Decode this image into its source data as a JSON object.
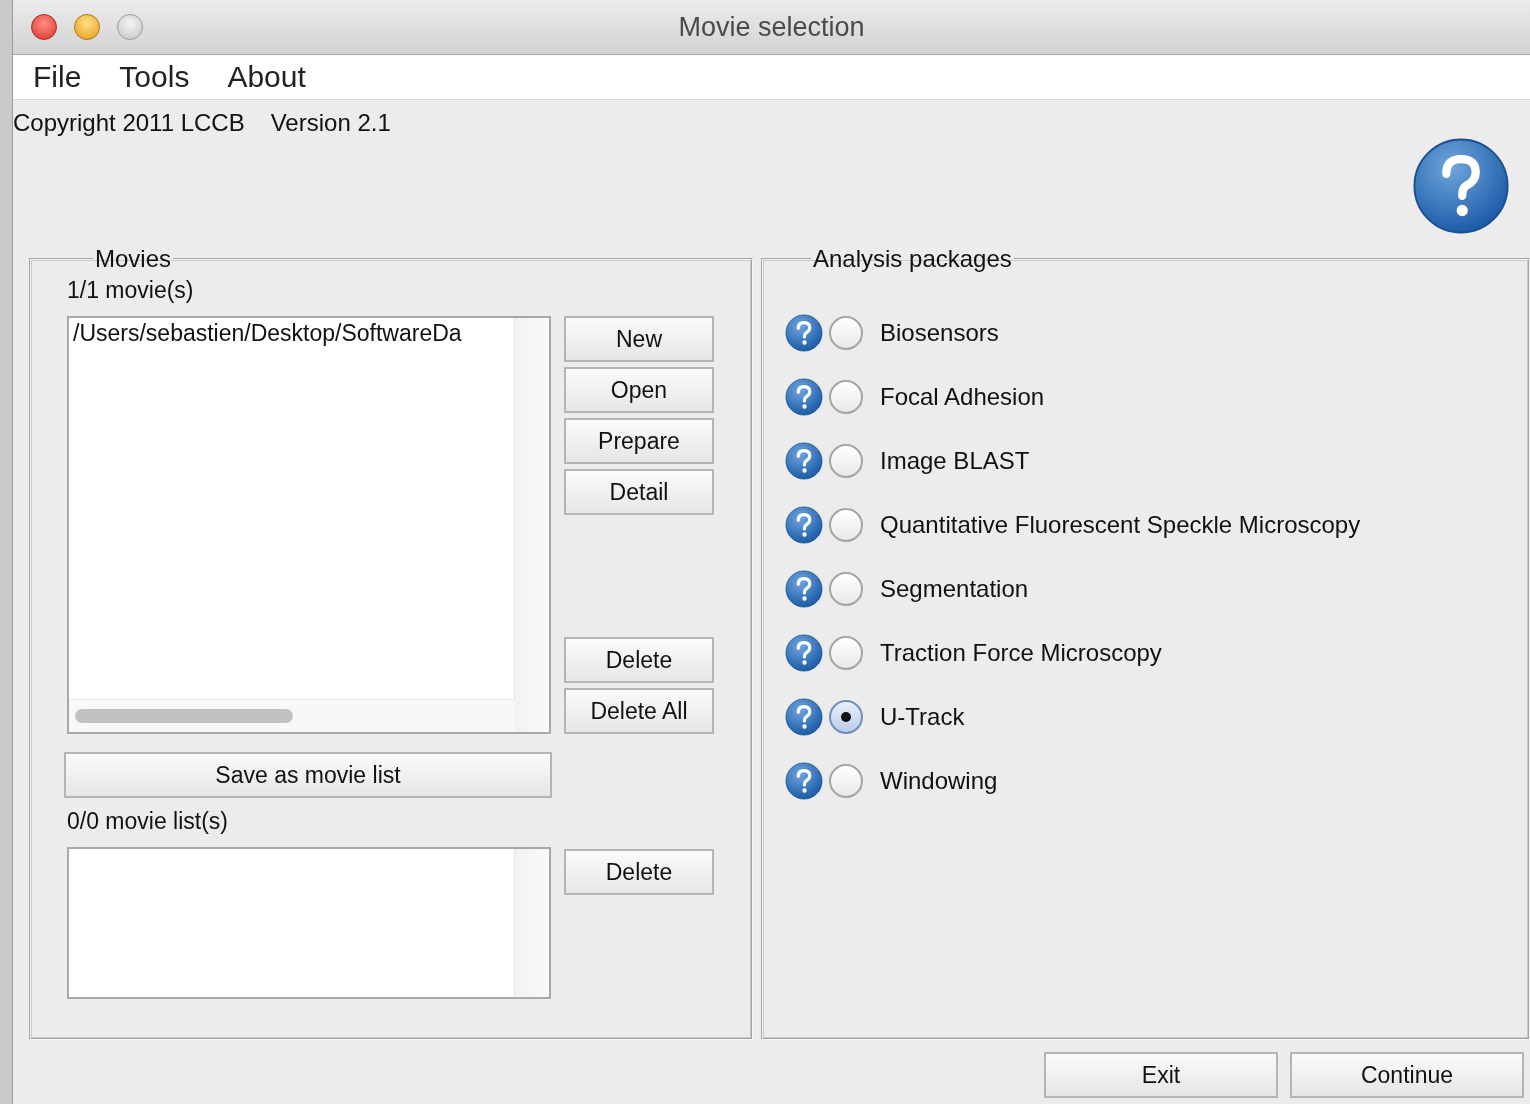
{
  "window": {
    "title": "Movie selection"
  },
  "menu": [
    "File",
    "Tools",
    "About"
  ],
  "header": {
    "copyright": "Copyright 2011 LCCB",
    "version": "Version 2.1"
  },
  "movies": {
    "title": "Movies",
    "count": "1/1 movie(s)",
    "items": [
      "/Users/sebastien/Desktop/SoftwareDa"
    ],
    "buttons": [
      "New",
      "Open",
      "Prepare",
      "Detail"
    ],
    "delete_buttons": [
      "Delete",
      "Delete All"
    ],
    "save_button": "Save as movie list",
    "list_count": "0/0 movie list(s)",
    "list_delete_button": "Delete"
  },
  "packages": {
    "title": "Analysis packages",
    "items": [
      {
        "label": "Biosensors",
        "selected": false
      },
      {
        "label": "Focal Adhesion",
        "selected": false
      },
      {
        "label": "Image BLAST",
        "selected": false
      },
      {
        "label": "Quantitative Fluorescent Speckle Microscopy",
        "selected": false
      },
      {
        "label": "Segmentation",
        "selected": false
      },
      {
        "label": "Traction Force Microscopy",
        "selected": false
      },
      {
        "label": "U-Track",
        "selected": true
      },
      {
        "label": "Windowing",
        "selected": false
      }
    ]
  },
  "footer_buttons": [
    "Exit",
    "Continue"
  ]
}
